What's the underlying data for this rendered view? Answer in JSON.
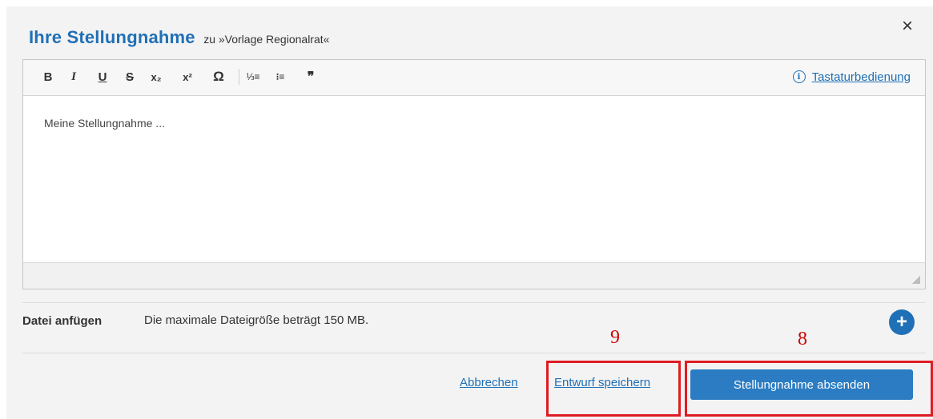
{
  "dialog": {
    "title": "Ihre Stellungnahme",
    "subtitle": "zu »Vorlage Regionalrat«",
    "close_icon": "×"
  },
  "toolbar": {
    "bold": "B",
    "italic": "I",
    "underline": "U",
    "strikethrough": "S",
    "subscript": "x₂",
    "superscript": "x²",
    "special_char": "Ω",
    "numbered_list": "⅓≡",
    "bulleted_list": "⁝≡",
    "blockquote": "❞",
    "keyboard_help_icon": "i",
    "keyboard_help_label": "Tastaturbedienung"
  },
  "editor": {
    "content": "Meine Stellungnahme ..."
  },
  "attachment": {
    "label": "Datei anfügen",
    "note": "Die maximale Dateigröße beträgt 150 MB.",
    "add_icon": "+"
  },
  "actions": {
    "cancel": "Abbrechen",
    "save_draft": "Entwurf speichern",
    "submit": "Stellungnahme absenden"
  },
  "annotations": {
    "save_draft_number": "9",
    "submit_number": "8",
    "highlight_color": "#e01b24"
  },
  "colors": {
    "accent": "#1f70b6",
    "primary_button": "#2b7cc2",
    "dialog_background": "#f3f3f3"
  }
}
